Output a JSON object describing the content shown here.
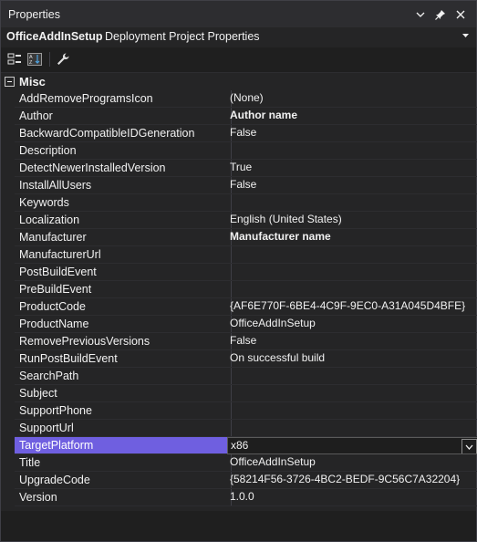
{
  "window": {
    "title": "Properties"
  },
  "selector": {
    "object_name": "OfficeAddInSetup",
    "object_type": "Deployment Project Properties"
  },
  "toolbar": {
    "icons": [
      "categorized-icon",
      "alphabetical-icon",
      "property-pages-icon"
    ]
  },
  "category": {
    "label": "Misc"
  },
  "properties": [
    {
      "name": "AddRemoveProgramsIcon",
      "value": "(None)"
    },
    {
      "name": "Author",
      "value": "Author name"
    },
    {
      "name": "BackwardCompatibleIDGeneration",
      "value": "False"
    },
    {
      "name": "Description",
      "value": ""
    },
    {
      "name": "DetectNewerInstalledVersion",
      "value": "True"
    },
    {
      "name": "InstallAllUsers",
      "value": "False"
    },
    {
      "name": "Keywords",
      "value": ""
    },
    {
      "name": "Localization",
      "value": "English (United States)"
    },
    {
      "name": "Manufacturer",
      "value": "Manufacturer name"
    },
    {
      "name": "ManufacturerUrl",
      "value": ""
    },
    {
      "name": "PostBuildEvent",
      "value": ""
    },
    {
      "name": "PreBuildEvent",
      "value": ""
    },
    {
      "name": "ProductCode",
      "value": "{AF6E770F-6BE4-4C9F-9EC0-A31A045D4BFE}"
    },
    {
      "name": "ProductName",
      "value": "OfficeAddInSetup"
    },
    {
      "name": "RemovePreviousVersions",
      "value": "False"
    },
    {
      "name": "RunPostBuildEvent",
      "value": "On successful build"
    },
    {
      "name": "SearchPath",
      "value": ""
    },
    {
      "name": "Subject",
      "value": ""
    },
    {
      "name": "SupportPhone",
      "value": ""
    },
    {
      "name": "SupportUrl",
      "value": ""
    },
    {
      "name": "TargetPlatform",
      "value": "x86"
    },
    {
      "name": "Title",
      "value": "OfficeAddInSetup"
    },
    {
      "name": "UpgradeCode",
      "value": "{58214F56-3726-4BC2-BEDF-9C56C7A32204}"
    },
    {
      "name": "Version",
      "value": "1.0.0"
    }
  ],
  "colors": {
    "selection": "#6f5fe0",
    "background": "#1f1f1f",
    "grid": "#252526"
  }
}
